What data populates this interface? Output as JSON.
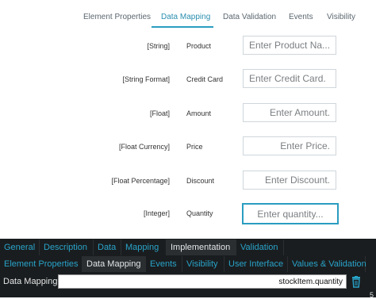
{
  "top_tabs": [
    {
      "label": "Element Properties"
    },
    {
      "label": "Data Mapping",
      "active": true
    },
    {
      "label": "Data Validation"
    },
    {
      "label": "Events"
    },
    {
      "label": "Visibility"
    }
  ],
  "rows": [
    {
      "type": "[String]",
      "label": "Product",
      "placeholder": "Enter Product Na..."
    },
    {
      "type": "[String Format]",
      "label": "Credit Card",
      "placeholder": "Enter Credit Card."
    },
    {
      "type": "[Float]",
      "label": "Amount",
      "placeholder": "Enter Amount."
    },
    {
      "type": "[Float Currency]",
      "label": "Price",
      "placeholder": "Enter Price."
    },
    {
      "type": "[Float Percentage]",
      "label": "Discount",
      "placeholder": "Enter Discount."
    },
    {
      "type": "[Integer]",
      "label": "Quantity",
      "placeholder": "Enter quantity..."
    }
  ],
  "panel": {
    "tabs1": [
      {
        "label": "General"
      },
      {
        "label": "Description"
      },
      {
        "label": "Data"
      },
      {
        "label": "Mapping"
      },
      {
        "label": "Implementation",
        "active": true
      },
      {
        "label": "Validation"
      }
    ],
    "tabs2": [
      {
        "label": "Element Properties"
      },
      {
        "label": "Data Mapping",
        "active": true
      },
      {
        "label": "Events"
      },
      {
        "label": "Visibility"
      },
      {
        "label": "User Interface"
      },
      {
        "label": "Values & Validation"
      }
    ],
    "data_mapping_label": "Data Mapping:",
    "data_mapping_value": "stockItem.quantity",
    "corner_text": "5"
  },
  "colors": {
    "accent": "#2a9dc0",
    "panel_bg": "#1a1d1f",
    "panel_tab_text": "#29a3c9"
  },
  "icons": {
    "trash": "trash-icon"
  }
}
